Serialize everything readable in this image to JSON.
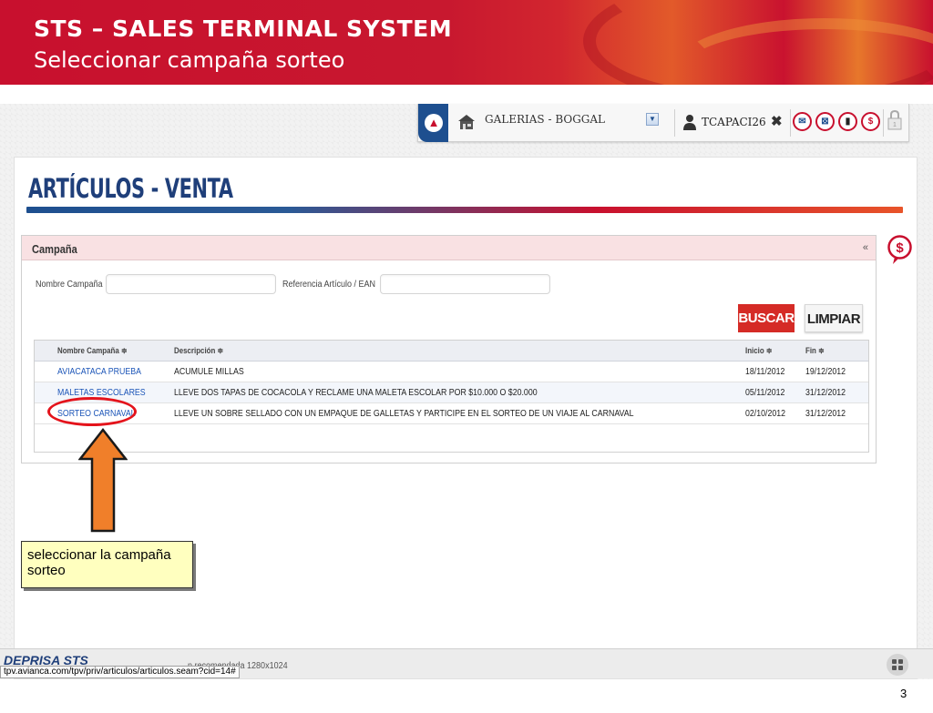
{
  "slide": {
    "title": "STS – SALES  TERMINAL SYSTEM",
    "subtitle": "Seleccionar campaña sorteo",
    "page_number": "3"
  },
  "toolbar": {
    "store": "GALERIAS - BOGGAL",
    "user": "TCAPACI26",
    "close_glyph": "✖",
    "icons": [
      "home-logo-icon",
      "store-icon",
      "dropdown-icon",
      "user-icon",
      "close-icon",
      "message-icon",
      "cancel-icon",
      "bag-icon",
      "dollar-icon",
      "lock-icon"
    ]
  },
  "page": {
    "heading": "ARTÍCULOS - VENTA"
  },
  "campaign": {
    "title": "Campaña",
    "collapse_glyph": "«",
    "filters": {
      "name_label": "Nombre Campaña",
      "name_value": "",
      "ref_label": "Referencia Artículo / EAN",
      "ref_value": ""
    },
    "buttons": {
      "search": "BUSCAR",
      "clear": "LIMPIAR"
    },
    "columns": {
      "name": "Nombre Campaña ≑",
      "description": "Descripción ≑",
      "start": "Inicio ≑",
      "end": "Fin ≑"
    },
    "rows": [
      {
        "name": "AVIACATACA PRUEBA",
        "description": "ACUMULE MILLAS",
        "start": "18/11/2012",
        "end": "19/12/2012"
      },
      {
        "name": "MALETAS ESCOLARES",
        "description": "LLEVE DOS TAPAS DE COCACOLA Y RECLAME UNA MALETA ESCOLAR POR $10.000 O $20.000",
        "start": "05/11/2012",
        "end": "31/12/2012"
      },
      {
        "name": "SORTEO CARNAVAL",
        "description": "LLEVE UN SOBRE SELLADO CON UN EMPAQUE DE GALLETAS Y PARTICIPE EN EL SORTEO DE UN VIAJE AL CARNAVAL",
        "start": "02/10/2012",
        "end": "31/12/2012"
      }
    ]
  },
  "annotation": {
    "callout": "seleccionar la campaña sorteo"
  },
  "statusbar": {
    "brand": "DEPRISA STS",
    "resolution": "n recomendada 1280x1024",
    "url": "tpv.avianca.com/tpv/priv/articulos/articulos.seam?cid=14#"
  },
  "colors": {
    "brand_red": "#c8102e",
    "brand_blue": "#1e4f8f",
    "link": "#1d56b8",
    "callout_bg": "#ffffbf",
    "arrow": "#f07f2a"
  }
}
